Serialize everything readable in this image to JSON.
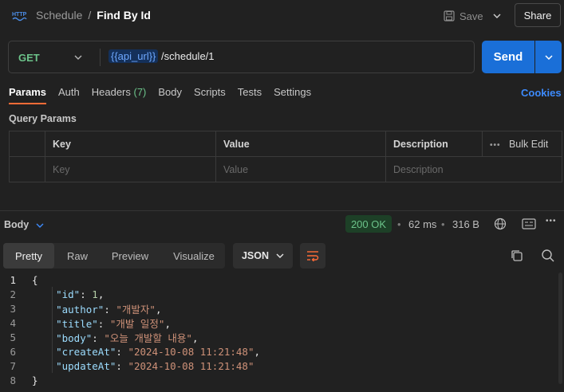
{
  "header": {
    "icon": "http-icon",
    "collection": "Schedule",
    "separator": "/",
    "request_name": "Find By Id",
    "save_label": "Save",
    "share_label": "Share"
  },
  "request": {
    "method": "GET",
    "url_variable": "{{api_url}}",
    "url_path": " /schedule/1",
    "send_label": "Send"
  },
  "tabs": {
    "params": "Params",
    "auth": "Auth",
    "headers": "Headers",
    "headers_count": "(7)",
    "body": "Body",
    "scripts": "Scripts",
    "tests": "Tests",
    "settings": "Settings",
    "cookies": "Cookies"
  },
  "query_params": {
    "title": "Query Params",
    "columns": {
      "key": "Key",
      "value": "Value",
      "description": "Description"
    },
    "bulk_edit": "Bulk Edit",
    "placeholders": {
      "key": "Key",
      "value": "Value",
      "description": "Description"
    }
  },
  "response": {
    "body_label": "Body",
    "status": "200 OK",
    "time": "62 ms",
    "size": "316 B",
    "colors": {
      "status_bg": "#1d4027",
      "status_text": "#6cc38a",
      "accent": "#1a6fd8",
      "tab_underline": "#ff6c37"
    },
    "view_tabs": [
      "Pretty",
      "Raw",
      "Preview",
      "Visualize"
    ],
    "format": "JSON",
    "code": {
      "l1_num": "1",
      "l1": "{",
      "l2_num": "2",
      "l2_key": "\"id\"",
      "l2_val": "1",
      "l3_num": "3",
      "l3_key": "\"author\"",
      "l3_val": "\"개발자\"",
      "l4_num": "4",
      "l4_key": "\"title\"",
      "l4_val": "\"개발 일정\"",
      "l5_num": "5",
      "l5_key": "\"body\"",
      "l5_val": "\"오늘 개발할 내용\"",
      "l6_num": "6",
      "l6_key": "\"createAt\"",
      "l6_val": "\"2024-10-08 11:21:48\"",
      "l7_num": "7",
      "l7_key": "\"updateAt\"",
      "l7_val": "\"2024-10-08 11:21:48\"",
      "l8_num": "8",
      "l8": "}"
    }
  }
}
